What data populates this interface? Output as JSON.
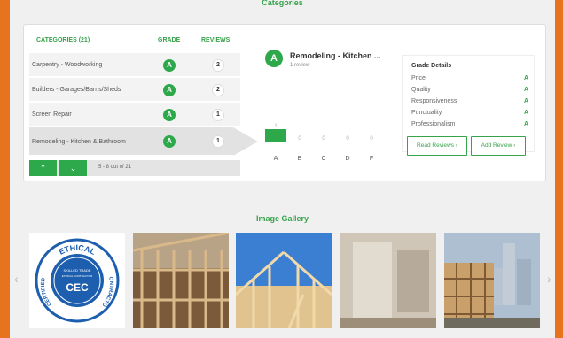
{
  "sections": {
    "categories_title": "Categories",
    "gallery_title": "Image Gallery"
  },
  "table": {
    "headers": {
      "categories": "CATEGORIES (21)",
      "grade": "GRADE",
      "reviews": "REVIEWS"
    },
    "rows": [
      {
        "name": "Carpentry - Woodworking",
        "grade": "A",
        "reviews": "2"
      },
      {
        "name": "Builders - Garages/Barns/Sheds",
        "grade": "A",
        "reviews": "2"
      },
      {
        "name": "Screen Repair",
        "grade": "A",
        "reviews": "1"
      },
      {
        "name": "Remodeling - Kitchen & Bathroom",
        "grade": "A",
        "reviews": "1"
      }
    ],
    "pager": {
      "up": "⌃",
      "down": "⌄",
      "text": "5 - 8 out of 21"
    }
  },
  "detail": {
    "badge": "A",
    "title": "Remodeling - Kitchen ...",
    "reviews_count": "1 review",
    "distribution": [
      {
        "letter": "A",
        "count": "1",
        "value": 1
      },
      {
        "letter": "B",
        "count": "0",
        "value": 0
      },
      {
        "letter": "C",
        "count": "0",
        "value": 0
      },
      {
        "letter": "D",
        "count": "0",
        "value": 0
      },
      {
        "letter": "F",
        "count": "0",
        "value": 0
      }
    ],
    "grade_details": {
      "title": "Grade Details",
      "items": [
        {
          "label": "Price",
          "value": "A"
        },
        {
          "label": "Quality",
          "value": "A"
        },
        {
          "label": "Responsiveness",
          "value": "A"
        },
        {
          "label": "Punctuality",
          "value": "A"
        },
        {
          "label": "Professionalism",
          "value": "A"
        }
      ]
    },
    "buttons": {
      "read_reviews": "Read Reviews ›",
      "add_review": "Add Review ›"
    }
  },
  "gallery": {
    "prev": "‹",
    "next": "›",
    "seal": {
      "top": "ETHICAL",
      "left": "CERTIFIED",
      "right": "CONTRACTOR",
      "inner1": "SKILLED TRADE",
      "inner2": "ETHICAL CONTRACTOR",
      "code": "CEC"
    },
    "images": [
      "cec-seal",
      "wood-frame-house",
      "framing-sky",
      "drywall-interior",
      "city-construction"
    ]
  },
  "colors": {
    "accent": "#2da84a",
    "border": "#e8731e"
  }
}
